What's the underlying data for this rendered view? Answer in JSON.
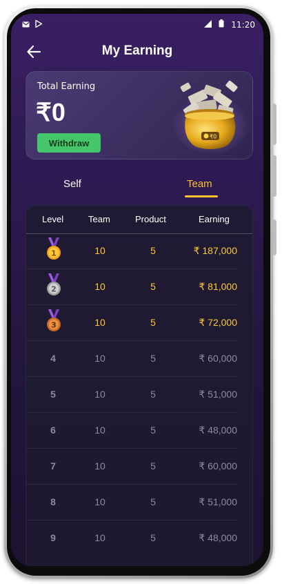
{
  "status_bar": {
    "time": "11:20"
  },
  "header": {
    "title": "My Earning"
  },
  "earning_card": {
    "label": "Total Earning",
    "amount": "₹0",
    "withdraw_label": "Withdraw",
    "pot_tag": "₹0"
  },
  "tabs": [
    {
      "label": "Self",
      "active": false
    },
    {
      "label": "Team",
      "active": true
    }
  ],
  "table": {
    "columns": [
      "Level",
      "Team",
      "Product",
      "Earning"
    ],
    "rows": [
      {
        "level": "1",
        "team": "10",
        "product": "5",
        "earning": "₹ 187,000",
        "medal": "gold-medal-icon"
      },
      {
        "level": "2",
        "team": "10",
        "product": "5",
        "earning": "₹ 81,000",
        "medal": "silver-medal-icon"
      },
      {
        "level": "3",
        "team": "10",
        "product": "5",
        "earning": "₹ 72,000",
        "medal": "bronze-medal-icon"
      },
      {
        "level": "4",
        "team": "10",
        "product": "5",
        "earning": "₹ 60,000"
      },
      {
        "level": "5",
        "team": "10",
        "product": "5",
        "earning": "₹ 51,000"
      },
      {
        "level": "6",
        "team": "10",
        "product": "5",
        "earning": "₹ 48,000"
      },
      {
        "level": "7",
        "team": "10",
        "product": "5",
        "earning": "₹ 60,000"
      },
      {
        "level": "8",
        "team": "10",
        "product": "5",
        "earning": "₹ 51,000"
      },
      {
        "level": "9",
        "team": "10",
        "product": "5",
        "earning": "₹ 48,000"
      }
    ]
  },
  "colors": {
    "accent": "#ffc02e",
    "withdraw": "#45c66b",
    "background_top": "#3a1f63",
    "muted_text": "#8d8aa3"
  }
}
